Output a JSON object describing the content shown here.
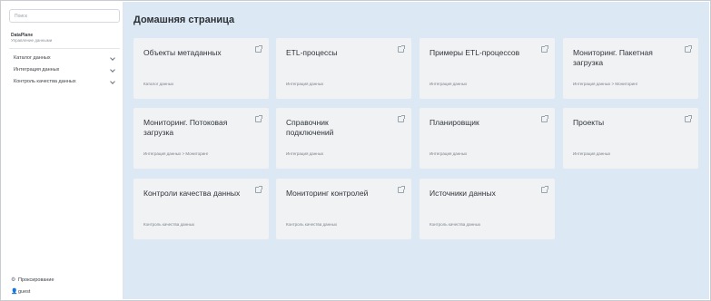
{
  "sidebar": {
    "search_placeholder": "Поиск",
    "brand_name": "DataPlane",
    "brand_sub": "Управление данными",
    "items": [
      {
        "label": "Каталог данных"
      },
      {
        "label": "Интеграция данных"
      },
      {
        "label": "Контроль качества данных"
      }
    ],
    "bottom": [
      {
        "label": "Проксирование",
        "icon": "gear-icon"
      },
      {
        "label": "guest",
        "icon": "user-icon"
      }
    ]
  },
  "main": {
    "title": "Домашняя страница",
    "cards": [
      {
        "title": "Объекты метаданных",
        "category": "Каталог данных"
      },
      {
        "title": "ETL-процессы",
        "category": "Интеграция данных"
      },
      {
        "title": "Примеры ETL-процессов",
        "category": "Интеграция данных"
      },
      {
        "title": "Мониторинг. Пакетная загрузка",
        "category": "Интеграция данных > Мониторинг"
      },
      {
        "title": "Мониторинг. Потоковая загрузка",
        "category": "Интеграция данных > Мониторинг"
      },
      {
        "title": "Справочник подключений",
        "category": "Интеграция данных"
      },
      {
        "title": "Планировщик",
        "category": "Интеграция данных"
      },
      {
        "title": "Проекты",
        "category": "Интеграция данных"
      },
      {
        "title": "Контроли качества данных",
        "category": "Контроль качества данных"
      },
      {
        "title": "Мониторинг контролей",
        "category": "Контроль качества данных"
      },
      {
        "title": "Источники данных",
        "category": "Контроль качества данных"
      }
    ]
  },
  "colors": {
    "main_background": "#dce8f3",
    "card_background": "#f1f2f4",
    "sidebar_background": "#ffffff"
  }
}
